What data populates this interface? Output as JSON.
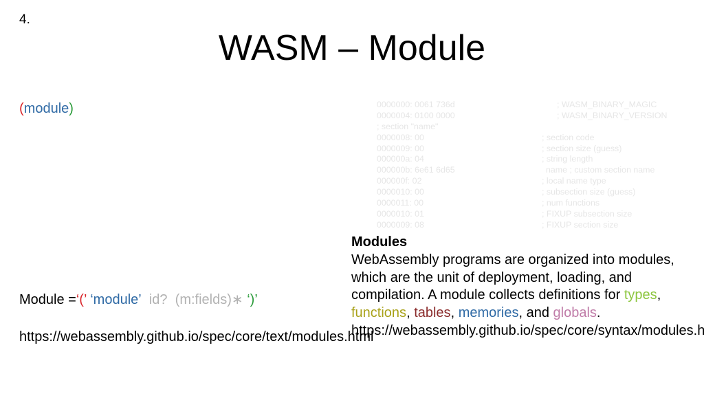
{
  "slide_number": "4.",
  "title": "WASM – Module",
  "module_expr": {
    "open": "(",
    "keyword": "module",
    "close": ")"
  },
  "hexdump": [
    {
      "left": "0000000: 0061 736d",
      "right": "; WASM_BINARY_MAGIC",
      "offset": "wide"
    },
    {
      "left": "0000004: 0100 0000",
      "right": "; WASM_BINARY_VERSION",
      "offset": "wide"
    },
    {
      "left": "; section \"name\"",
      "right": ""
    },
    {
      "left": "0000008: 00",
      "right": "; section code"
    },
    {
      "left": "0000009: 00",
      "right": "; section size (guess)"
    },
    {
      "left": "000000a: 04",
      "right": "; string length"
    },
    {
      "left": "000000b: 6e61 6d65",
      "right": "name  ; custom section name",
      "offset": "mid"
    },
    {
      "left": "000000f: 02",
      "right": "; local name type"
    },
    {
      "left": "0000010: 00",
      "right": "; subsection size (guess)"
    },
    {
      "left": "0000011: 00",
      "right": "; num functions"
    },
    {
      "left": "0000010: 01",
      "right": "; FIXUP subsection size"
    },
    {
      "left": "0000009: 08",
      "right": "; FIXUP section size"
    }
  ],
  "grammar": {
    "lhs": "Module =",
    "lparen": "‘(’",
    "kw": "‘module’",
    "id": "id?",
    "fields": "(m:fields)",
    "star": "∗",
    "rparen": "‘)’"
  },
  "left_url": "https://webassembly.github.io/spec/core/text/modules.html",
  "modules_text": {
    "heading": "Modules",
    "p1": "WebAssembly programs are organized into modules, which are the unit of deployment, loading, and compilation.  A module collects definitions for ",
    "types": "types",
    "sep1": ", ",
    "functions": "functions",
    "sep2": ", ",
    "tables": "tables",
    "sep3": ",",
    "memories": "memories",
    "sep4": ", and ",
    "globals": "globals",
    "end": ".",
    "url": "https://webassembly.github.io/spec/core/syntax/modules.html"
  }
}
